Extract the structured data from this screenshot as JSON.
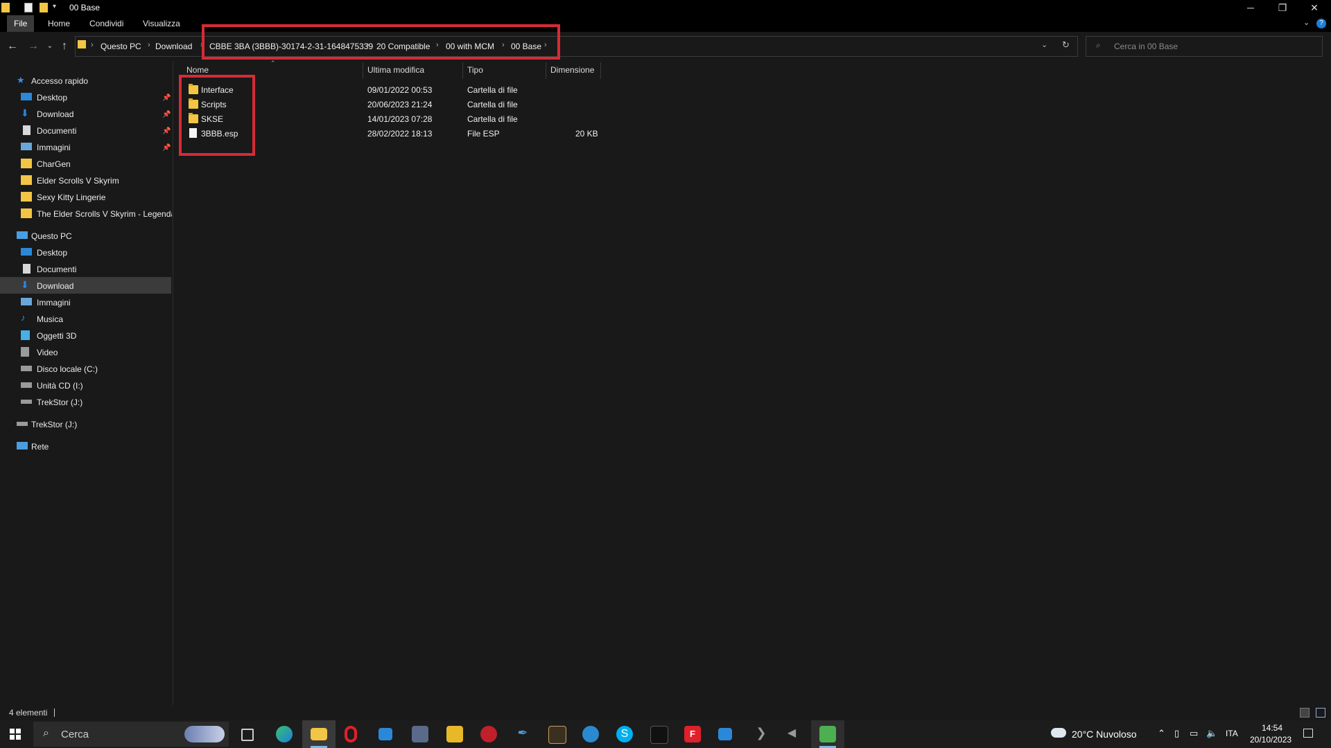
{
  "window": {
    "title": "00 Base",
    "minimize_icon": "minimize-icon",
    "maximize_icon": "restore-icon",
    "close_icon": "close-icon"
  },
  "ribbon": {
    "tabs": [
      "File",
      "Home",
      "Condividi",
      "Visualizza"
    ]
  },
  "breadcrumb": {
    "items": [
      "Questo PC",
      "Download",
      "CBBE 3BA (3BBB)-30174-2-31-1648475339",
      "20 Compatible",
      "00 with MCM",
      "00 Base"
    ]
  },
  "search": {
    "placeholder": "Cerca in 00 Base"
  },
  "sidebar": {
    "quick_access": "Accesso rapido",
    "quick_items": [
      {
        "label": "Desktop",
        "icon": "desktop-icon",
        "pinned": true
      },
      {
        "label": "Download",
        "icon": "download-icon",
        "pinned": true
      },
      {
        "label": "Documenti",
        "icon": "documents-icon",
        "pinned": true
      },
      {
        "label": "Immagini",
        "icon": "pictures-icon",
        "pinned": true
      },
      {
        "label": "CharGen",
        "icon": "folder-icon",
        "pinned": false
      },
      {
        "label": "Elder Scrolls V  Skyrim",
        "icon": "folder-icon",
        "pinned": false
      },
      {
        "label": "Sexy Kitty Lingerie",
        "icon": "folder-icon",
        "pinned": false
      },
      {
        "label": "The Elder Scrolls V Skyrim - Legendar",
        "icon": "folder-icon",
        "pinned": false
      }
    ],
    "this_pc": "Questo PC",
    "pc_items": [
      {
        "label": "Desktop",
        "icon": "desktop-icon"
      },
      {
        "label": "Documenti",
        "icon": "documents-icon"
      },
      {
        "label": "Download",
        "icon": "download-icon",
        "selected": true
      },
      {
        "label": "Immagini",
        "icon": "pictures-icon"
      },
      {
        "label": "Musica",
        "icon": "music-icon"
      },
      {
        "label": "Oggetti 3D",
        "icon": "3d-objects-icon"
      },
      {
        "label": "Video",
        "icon": "video-icon"
      },
      {
        "label": "Disco locale (C:)",
        "icon": "drive-icon"
      },
      {
        "label": "Unità CD (I:)",
        "icon": "cd-drive-icon"
      },
      {
        "label": "TrekStor (J:)",
        "icon": "usb-drive-icon"
      }
    ],
    "trekstor": "TrekStor (J:)",
    "network": "Rete"
  },
  "columns": [
    "Nome",
    "Ultima modifica",
    "Tipo",
    "Dimensione"
  ],
  "files": [
    {
      "name": "Interface",
      "modified": "09/01/2022 00:53",
      "type": "Cartella di file",
      "size": "",
      "icon": "folder-icon"
    },
    {
      "name": "Scripts",
      "modified": "20/06/2023 21:24",
      "type": "Cartella di file",
      "size": "",
      "icon": "folder-icon"
    },
    {
      "name": "SKSE",
      "modified": "14/01/2023 07:28",
      "type": "Cartella di file",
      "size": "",
      "icon": "folder-icon"
    },
    {
      "name": "3BBB.esp",
      "modified": "28/02/2022 18:13",
      "type": "File ESP",
      "size": "20 KB",
      "icon": "file-icon"
    }
  ],
  "status": {
    "count": "4 elementi"
  },
  "taskbar": {
    "search_placeholder": "Cerca",
    "weather": "20°C  Nuvoloso",
    "language": "ITA",
    "time": "14:54",
    "date": "20/10/2023"
  },
  "colors": {
    "highlight": "#d62b36",
    "folder": "#f3c545",
    "selected_bg": "#3b3b3b"
  }
}
